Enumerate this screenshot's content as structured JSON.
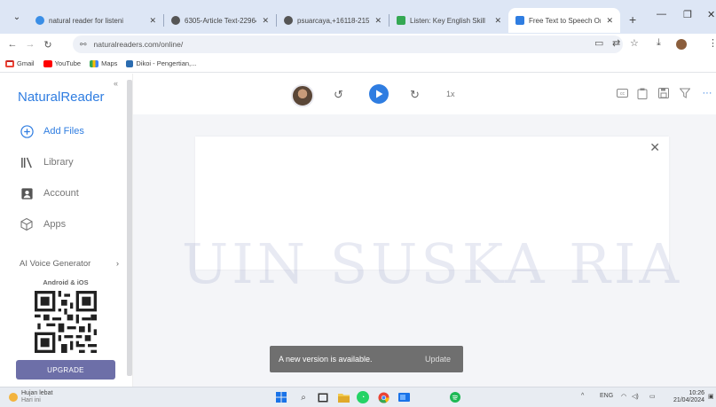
{
  "browser": {
    "tabs": [
      {
        "title": "natural reader for listeni",
        "active": false
      },
      {
        "title": "6305-Article Text-22964-",
        "active": false
      },
      {
        "title": "psuarcaya,+16118-21555-",
        "active": false
      },
      {
        "title": "Listen: Key English Skill",
        "active": false
      },
      {
        "title": "Free Text to Speech Onli",
        "active": true
      }
    ],
    "url": "naturalreaders.com/online/",
    "bookmarks": [
      "Gmail",
      "YouTube",
      "Maps",
      "Dikoi - Pengertian,..."
    ]
  },
  "sidebar": {
    "logo": "NaturalReader",
    "nav": [
      {
        "label": "Add Files"
      },
      {
        "label": "Library"
      },
      {
        "label": "Account"
      },
      {
        "label": "Apps"
      }
    ],
    "voice_generator": "AI Voice Generator",
    "android_ios": "Android & iOS",
    "upgrade": "UPGRADE"
  },
  "player": {
    "speed": "1x"
  },
  "content": {
    "watermark": "UIN SUSKA RIA",
    "toast_message": "A new version is available.",
    "toast_action": "Update"
  },
  "taskbar": {
    "weather_title": "Hujan lebat",
    "weather_sub": "Hari ini",
    "lang": "ENG",
    "time": "10:26",
    "date": "21/04/2024"
  },
  "colors": {
    "accent": "#2f7de1",
    "upgrade_button": "#6d6fa8",
    "toast_bg": "#6f6f6f",
    "tabbar_bg": "#dde6f5"
  }
}
